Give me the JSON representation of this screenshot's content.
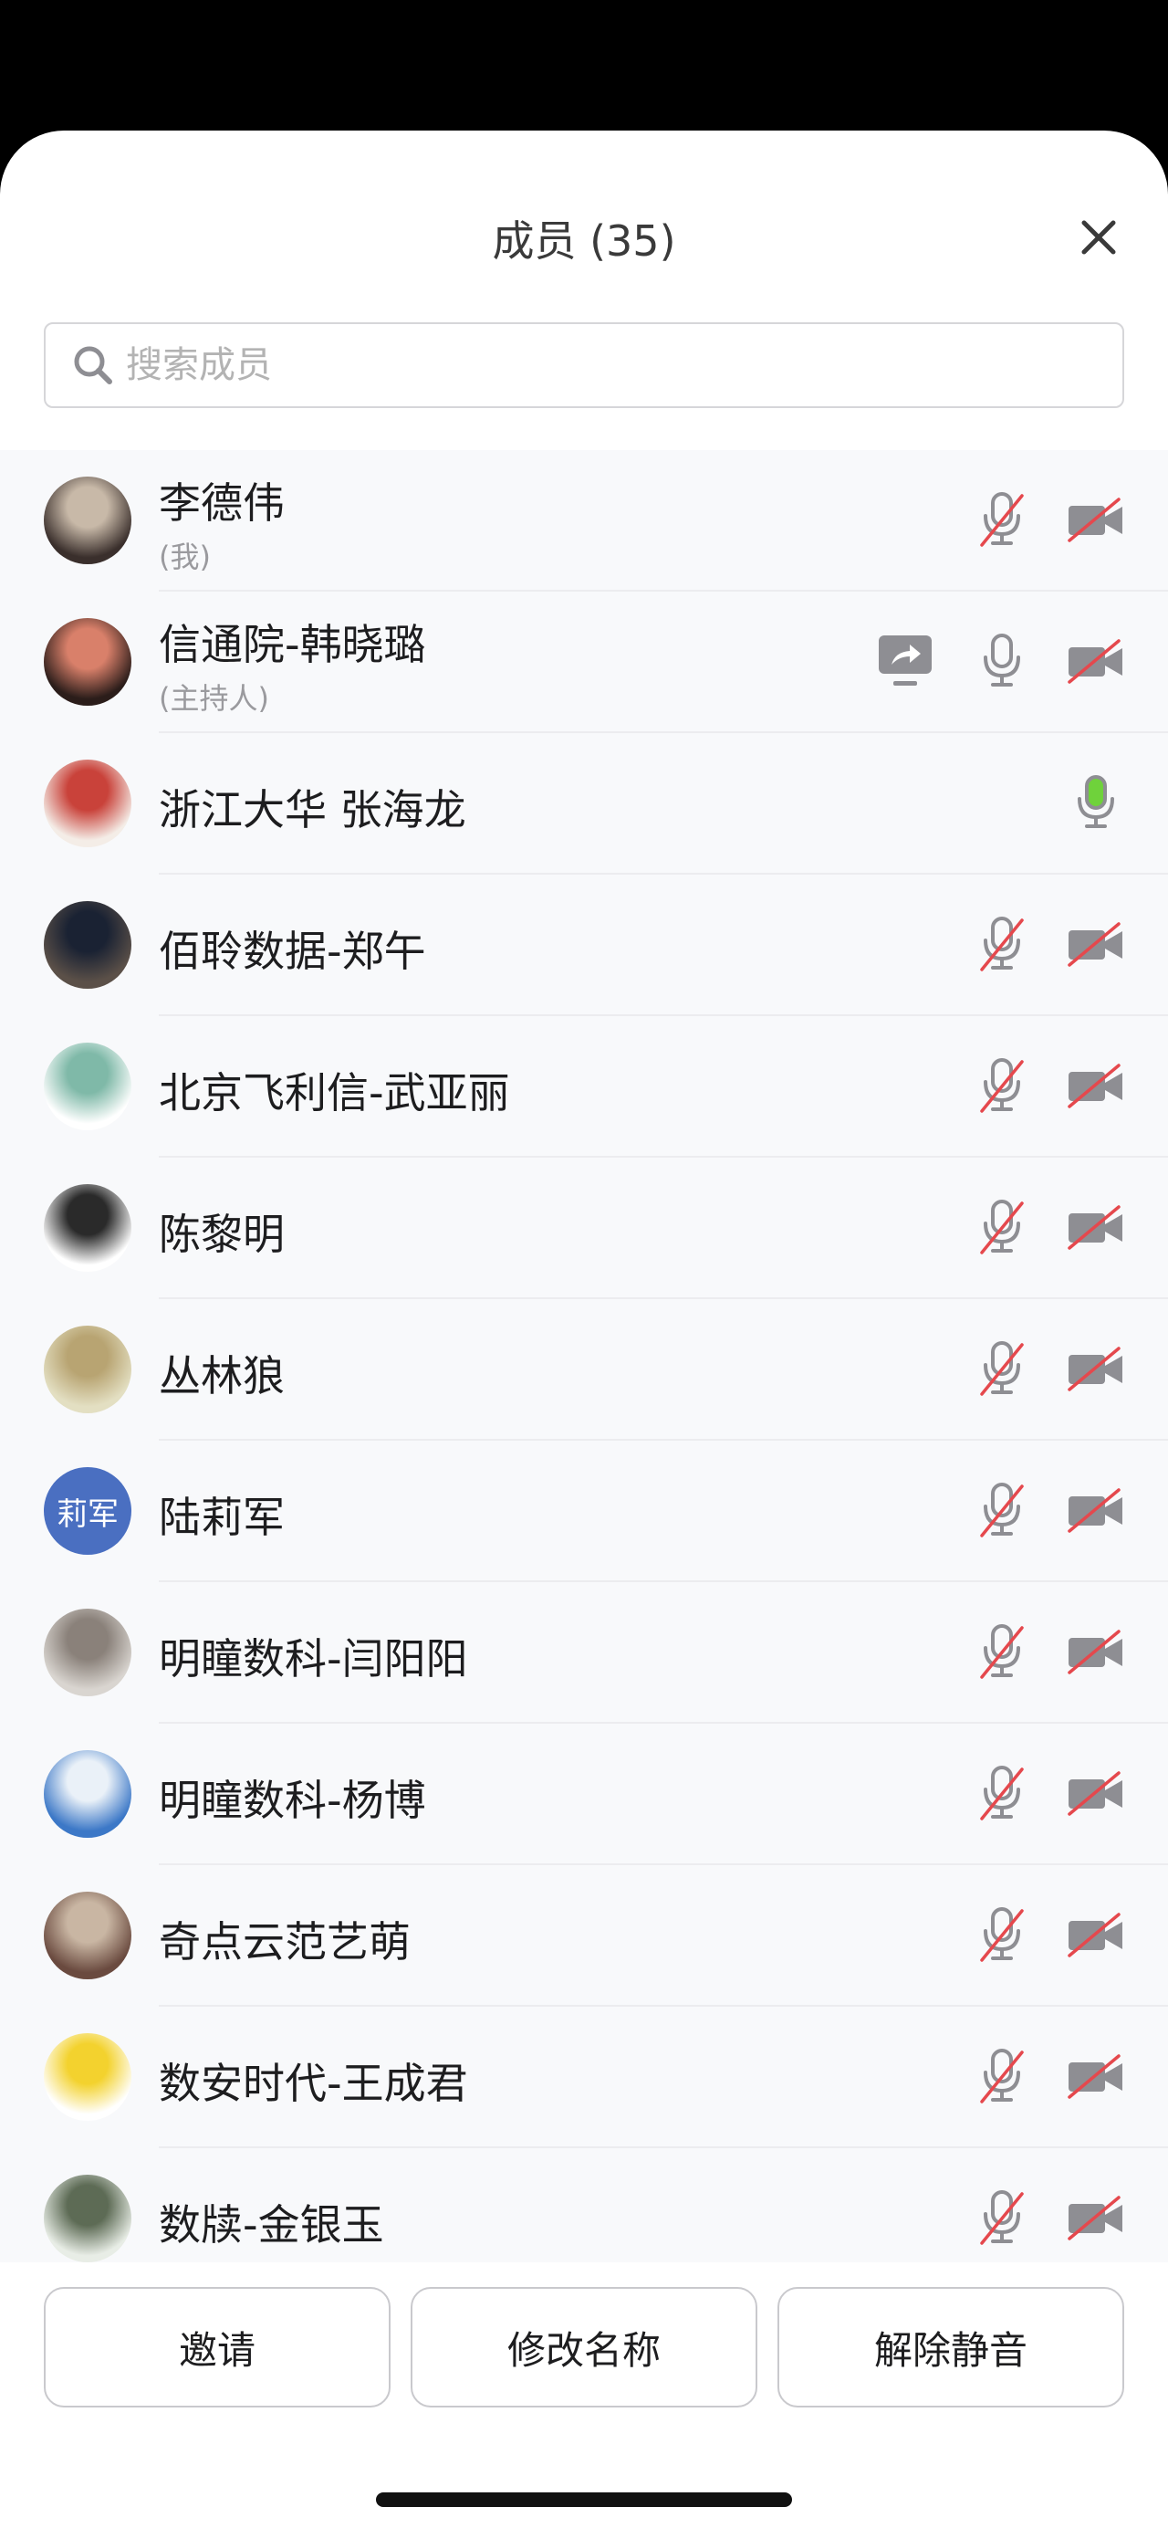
{
  "header": {
    "title": "成员 (35)"
  },
  "search": {
    "placeholder": "搜索成员"
  },
  "members": [
    {
      "name": "李德伟",
      "sub": "(我)",
      "avatar": {
        "kind": "photo",
        "colors": [
          "#3a2f2c",
          "#c8b9a8"
        ]
      },
      "share": false,
      "mic": "muted",
      "camera": "off"
    },
    {
      "name": "信通院-韩晓璐",
      "sub": "(主持人)",
      "avatar": {
        "kind": "photo",
        "colors": [
          "#2b1d1a",
          "#d9806a"
        ]
      },
      "share": true,
      "mic": "on",
      "camera": "off"
    },
    {
      "name": "浙江大华 张海龙",
      "sub": "",
      "avatar": {
        "kind": "photo",
        "colors": [
          "#f4ede7",
          "#c9423a"
        ]
      },
      "share": false,
      "mic": "speaking",
      "camera": "none"
    },
    {
      "name": "佰聆数据-郑午",
      "sub": "",
      "avatar": {
        "kind": "photo",
        "colors": [
          "#5b5048",
          "#1a2233"
        ]
      },
      "share": false,
      "mic": "muted",
      "camera": "off"
    },
    {
      "name": "北京飞利信-武亚丽",
      "sub": "",
      "avatar": {
        "kind": "photo",
        "colors": [
          "#ffffff",
          "#7fb9a8"
        ]
      },
      "share": false,
      "mic": "muted",
      "camera": "off"
    },
    {
      "name": "陈黎明",
      "sub": "",
      "avatar": {
        "kind": "photo",
        "colors": [
          "#ffffff",
          "#2a2a2a"
        ]
      },
      "share": false,
      "mic": "muted",
      "camera": "off"
    },
    {
      "name": "丛林狼",
      "sub": "",
      "avatar": {
        "kind": "photo",
        "colors": [
          "#e3dfc2",
          "#b8a472"
        ]
      },
      "share": false,
      "mic": "muted",
      "camera": "off"
    },
    {
      "name": "陆莉军",
      "sub": "",
      "avatar": {
        "kind": "text",
        "text": "莉军",
        "colors": [
          "#4a6fc1",
          "#4a6fc1"
        ]
      },
      "share": false,
      "mic": "muted",
      "camera": "off"
    },
    {
      "name": "明瞳数科-闫阳阳",
      "sub": "",
      "avatar": {
        "kind": "photo",
        "colors": [
          "#d9d5d0",
          "#8a817a"
        ]
      },
      "share": false,
      "mic": "muted",
      "camera": "off"
    },
    {
      "name": "明瞳数科-杨博",
      "sub": "",
      "avatar": {
        "kind": "photo",
        "colors": [
          "#3c78c7",
          "#eaf1f8"
        ]
      },
      "share": false,
      "mic": "muted",
      "camera": "off"
    },
    {
      "name": "奇点云范艺萌",
      "sub": "",
      "avatar": {
        "kind": "photo",
        "colors": [
          "#6a4a3f",
          "#c9b6a3"
        ]
      },
      "share": false,
      "mic": "muted",
      "camera": "off"
    },
    {
      "name": "数安时代-王成君",
      "sub": "",
      "avatar": {
        "kind": "photo",
        "colors": [
          "#ffffff",
          "#f3d22e"
        ]
      },
      "share": false,
      "mic": "muted",
      "camera": "off"
    },
    {
      "name": "数牍-金银玉",
      "sub": "",
      "avatar": {
        "kind": "photo",
        "colors": [
          "#e8ede6",
          "#5d6b55"
        ]
      },
      "share": false,
      "mic": "muted",
      "camera": "off"
    }
  ],
  "footer": {
    "invite": "邀请",
    "rename": "修改名称",
    "unmute": "解除静音"
  },
  "colors": {
    "muted_slash": "#e5484d",
    "speaking": "#6fd23b",
    "icon_gray": "#8e8e93"
  }
}
